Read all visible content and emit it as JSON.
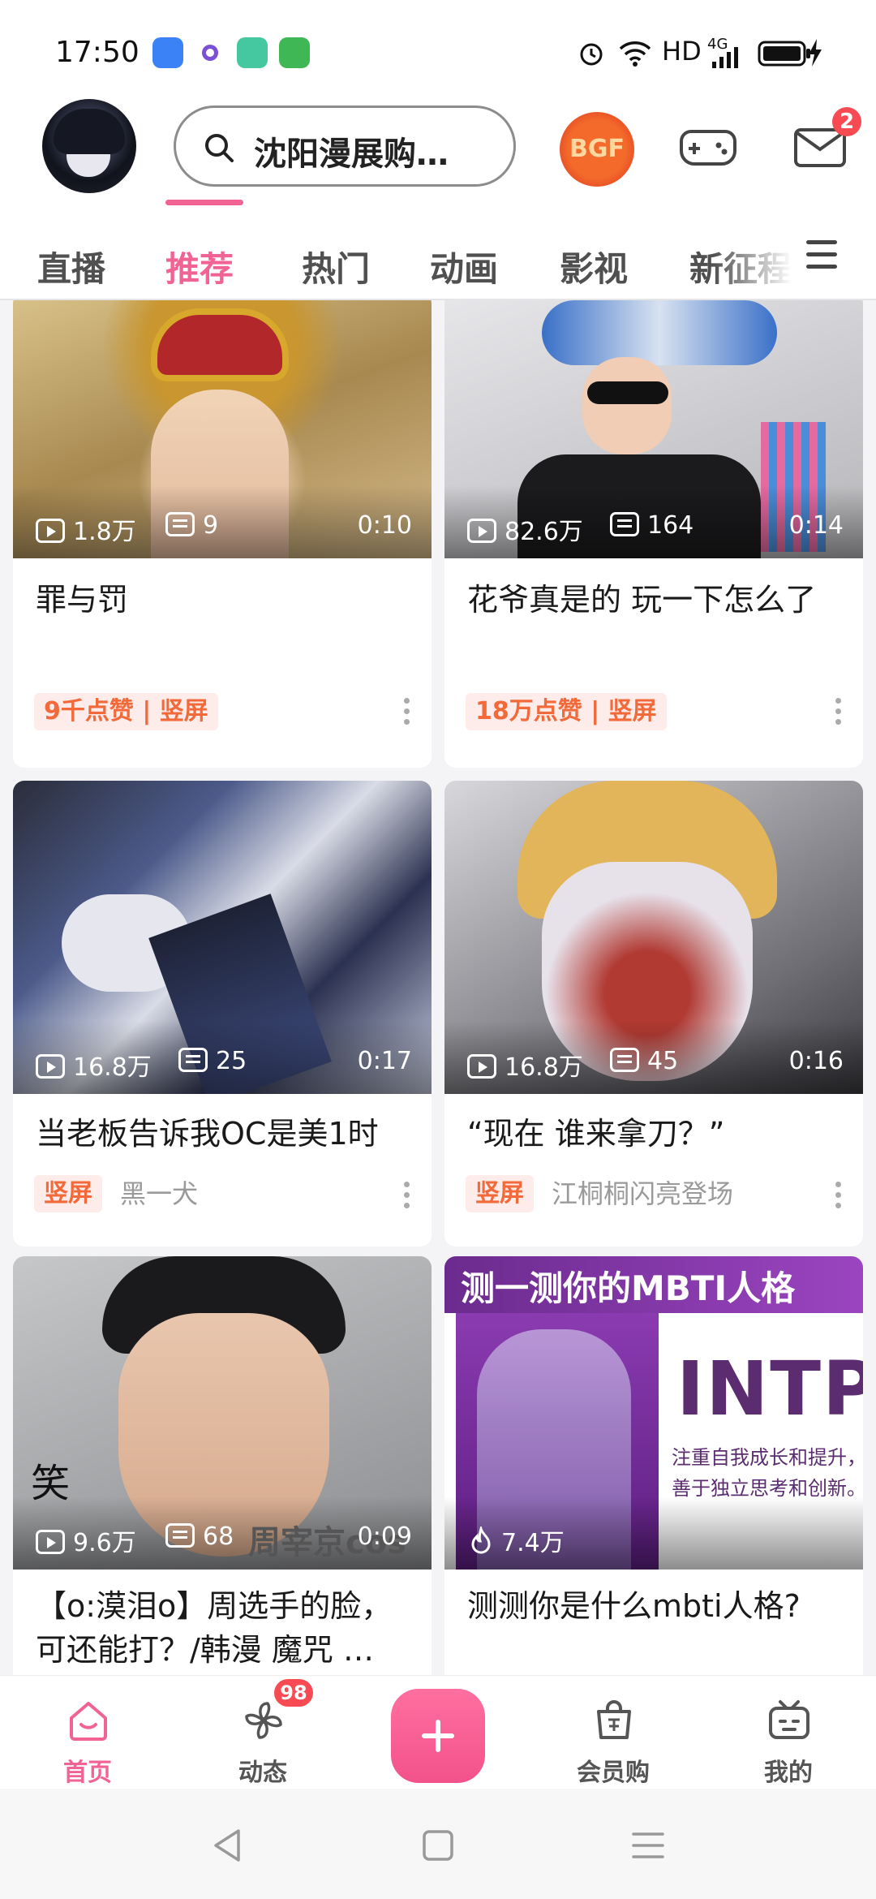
{
  "status_bar": {
    "time": "17:50",
    "net": "HD",
    "signal": "4G"
  },
  "header": {
    "search_placeholder": "沈阳漫展购…",
    "event_logo_text": "BGF",
    "mail_badge": "2"
  },
  "tabs": [
    "直播",
    "推荐",
    "热门",
    "动画",
    "影视",
    "新征程"
  ],
  "active_tab": "推荐",
  "cards": [
    {
      "plays": "1.8万",
      "danmaku": "9",
      "duration": "0:10",
      "title": "罪与罚",
      "tag": "9千点赞 | 竖屏",
      "author": ""
    },
    {
      "plays": "82.6万",
      "danmaku": "164",
      "duration": "0:14",
      "title": "花爷真是的 玩一下怎么了",
      "tag": "18万点赞 | 竖屏",
      "author": ""
    },
    {
      "plays": "16.8万",
      "danmaku": "25",
      "duration": "0:17",
      "title": "当老板告诉我OC是美1时",
      "tag": "竖屏",
      "author": "黑一犬"
    },
    {
      "plays": "16.8万",
      "danmaku": "45",
      "duration": "0:16",
      "title": "“现在 谁来拿刀？”",
      "tag": "竖屏",
      "author": "江桐桐闪亮登场"
    },
    {
      "plays": "9.6万",
      "danmaku": "68",
      "duration": "0:09",
      "title": "【o:漠泪o】周选手的脸，可还能打？/韩漫 魔咒 …",
      "thumb_text": "周宰京cos",
      "side_text": "笑"
    },
    {
      "plays": "7.4万",
      "title": "测测你是什么mbti人格?",
      "thumb_heading": "测一测你的MBTI人格",
      "thumb_type": "INTP",
      "thumb_desc_1": "注重自我成长和提升，",
      "thumb_desc_2": "善于独立思考和创新。"
    }
  ],
  "bottom_nav": {
    "home": "首页",
    "dynamic": "动态",
    "dynamic_badge": "98",
    "vip_shop": "会员购",
    "mine": "我的"
  },
  "colors": {
    "accent": "#f06392",
    "tag_text": "#f2693a",
    "badge": "#f74a52"
  }
}
